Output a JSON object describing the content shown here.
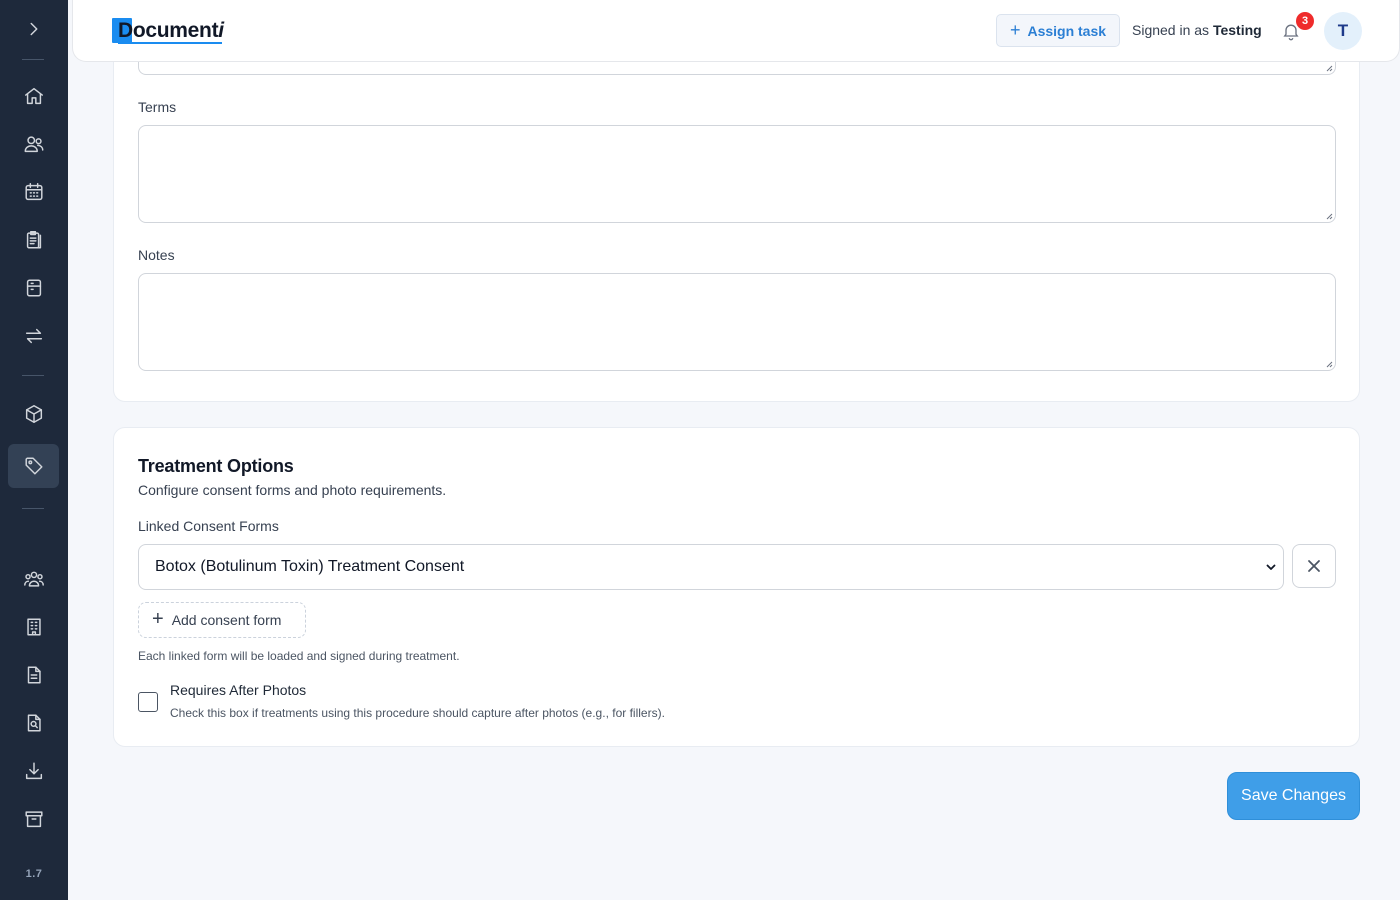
{
  "app": {
    "logo_text": "Document",
    "logo_suffix": "i",
    "version": "1.7",
    "accent_color": "#1a8cf0"
  },
  "header": {
    "assign_task_label": "Assign task",
    "signed_in_prefix": "Signed in as",
    "signed_in_user": "Testing",
    "notification_count": "3",
    "avatar_initial": "T"
  },
  "sidebar": {
    "items": [
      {
        "icon": "expand-chevron-icon"
      },
      {
        "icon": "home-icon"
      },
      {
        "icon": "users-icon"
      },
      {
        "icon": "calendar-icon"
      },
      {
        "icon": "clipboard-icon"
      },
      {
        "icon": "cabinet-icon"
      },
      {
        "icon": "transfer-icon"
      },
      {
        "icon": "box-icon"
      },
      {
        "icon": "tag-icon",
        "active": true
      },
      {
        "icon": "team-icon"
      },
      {
        "icon": "building-icon"
      },
      {
        "icon": "document-icon"
      },
      {
        "icon": "document-search-icon"
      },
      {
        "icon": "download-icon"
      },
      {
        "icon": "archive-icon"
      }
    ]
  },
  "form": {
    "terms_label": "Terms",
    "terms_value": "",
    "notes_label": "Notes",
    "notes_value": ""
  },
  "treatment": {
    "title": "Treatment Options",
    "subtitle": "Configure consent forms and photo requirements.",
    "linked_forms_label": "Linked Consent Forms",
    "selected_form": "Botox (Botulinum Toxin) Treatment Consent",
    "add_form_label": "Add consent form",
    "help_text": "Each linked form will be loaded and signed during treatment.",
    "after_photos_label": "Requires After Photos",
    "after_photos_help": "Check this box if treatments using this procedure should capture after photos (e.g., for fillers).",
    "after_photos_checked": false
  },
  "actions": {
    "save_label": "Save Changes"
  }
}
